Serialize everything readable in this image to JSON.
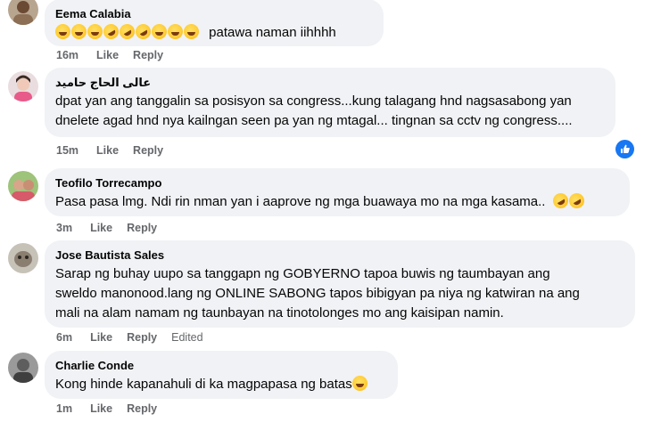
{
  "comments": [
    {
      "author": "Eema Calabia",
      "text": "patawa naman iihhhh",
      "emoji_prefix": [
        "joy",
        "joy",
        "joy",
        "rofl",
        "rofl",
        "rofl",
        "joy",
        "joy",
        "joy"
      ],
      "time": "16m",
      "like": "Like",
      "reply": "Reply"
    },
    {
      "author": "عالى الحاج حامید",
      "lines": [
        "dpat yan ang tanggalin sa posisyon sa congress...kung talagang hnd nagsasabong yan",
        "dnelete agad hnd nya kailngan seen pa yan ng mtagal... tingnan sa cctv ng congress...."
      ],
      "time": "15m",
      "like": "Like",
      "reply": "Reply",
      "reaction": "like-reaction"
    },
    {
      "author": "Teofilo Torrecampo",
      "text": "Pasa pasa lmg. Ndi rin nman yan i aaprove ng mga buawaya mo na mga kasama..",
      "emoji_suffix": [
        "rofl",
        "rofl"
      ],
      "time": "3m",
      "like": "Like",
      "reply": "Reply"
    },
    {
      "author": "Jose Bautista Sales",
      "lines": [
        "Sarap ng buhay uupo sa tanggapn ng GOBYERNO tapoa buwis ng taumbayan ang",
        "sweldo manonood.lang ng ONLINE SABONG tapos bibigyan pa niya ng katwiran na ang",
        "mali na alam namam ng taunbayan na tinotolonges mo ang kaisipan namin."
      ],
      "time": "6m",
      "like": "Like",
      "reply": "Reply",
      "edited": "Edited"
    },
    {
      "author": "Charlie Conde",
      "text": "Kong hinde kapanahuli di ka magpapasa ng batas",
      "emoji_suffix": [
        "joy"
      ],
      "time": "1m",
      "like": "Like",
      "reply": "Reply"
    }
  ],
  "colors": {
    "bubble": "#f0f2f5",
    "meta": "#65676b",
    "like_blue": "#1877f2"
  }
}
